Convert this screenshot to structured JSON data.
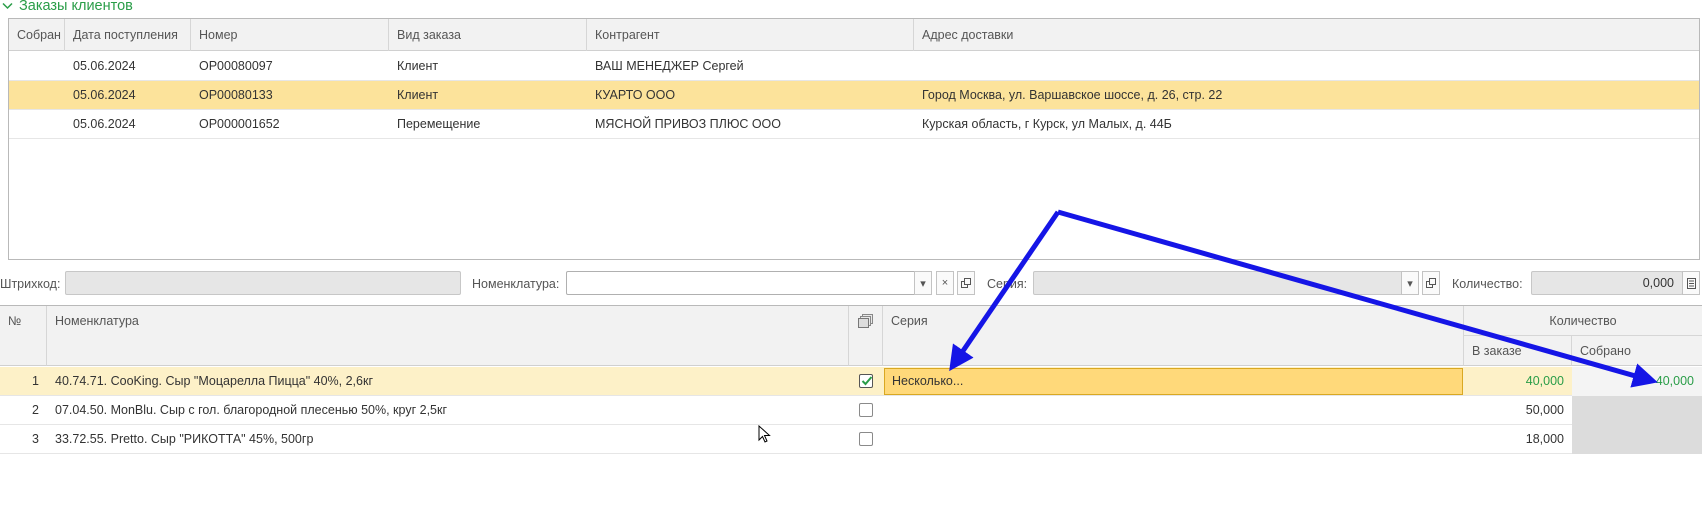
{
  "section": {
    "title": "Заказы клиентов"
  },
  "orders": {
    "columns": [
      "Собран",
      "Дата поступления",
      "Номер",
      "Вид заказа",
      "Контрагент",
      "Адрес доставки"
    ],
    "rows": [
      {
        "collected": "",
        "date": "05.06.2024",
        "number": "ОР00080097",
        "type": "Клиент",
        "partner": "ВАШ МЕНЕДЖЕР Сергей",
        "address": ""
      },
      {
        "collected": "",
        "date": "05.06.2024",
        "number": "ОР00080133",
        "type": "Клиент",
        "partner": "КУАРТО ООО",
        "address": "Город Москва, ул. Варшавское шоссе, д. 26, стр. 22",
        "selected": true
      },
      {
        "collected": "",
        "date": "05.06.2024",
        "number": "ОР000001652",
        "type": "Перемещение",
        "partner": "МЯСНОЙ ПРИВОЗ ПЛЮС ООО",
        "address": "Курская область, г Курск, ул Малых, д. 44Б"
      }
    ]
  },
  "filters": {
    "barcode_label": "Штрихкод:",
    "barcode_value": "",
    "nomenclature_label": "Номенклатура:",
    "nomenclature_value": "",
    "series_label": "Серия:",
    "series_value": "",
    "quantity_label": "Количество:",
    "quantity_value": "0,000"
  },
  "goods": {
    "headers": {
      "no": "№",
      "item": "Номенклатура",
      "series": "Серия",
      "qty_group": "Количество",
      "ordered": "В заказе",
      "collected": "Собрано"
    },
    "rows": [
      {
        "no": "1",
        "item": "40.74.71. CooKing. Сыр \"Моцарелла Пицца\" 40%, 2,6кг",
        "checked": true,
        "series": "Несколько...",
        "ordered": "40,000",
        "collected": "40,000",
        "selected": true
      },
      {
        "no": "2",
        "item": "07.04.50. MonBlu. Сыр с гол. благородной плесенью 50%, круг 2,5кг",
        "checked": false,
        "series": "",
        "ordered": "50,000",
        "collected": ""
      },
      {
        "no": "3",
        "item": "33.72.55. Pretto. Сыр \"РИКОТТА\" 45%, 500гр",
        "checked": false,
        "series": "",
        "ordered": "18,000",
        "collected": ""
      }
    ]
  },
  "colors": {
    "accent_green": "#2a9d48",
    "selection": "#fce39b",
    "arrow": "#1515e6"
  }
}
